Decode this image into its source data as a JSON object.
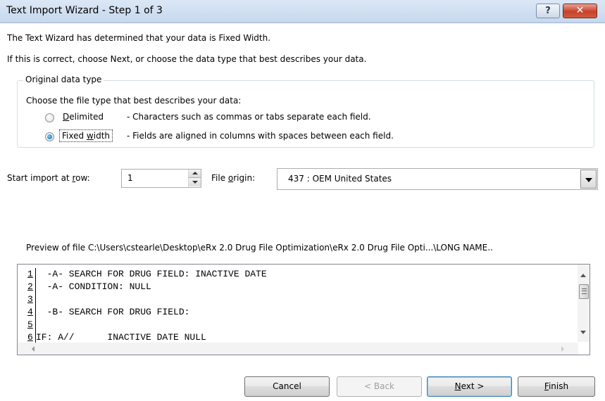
{
  "window": {
    "title": "Text Import Wizard - Step 1 of 3",
    "help_label": "?",
    "close_label": "✕"
  },
  "intro": {
    "line1": "The Text Wizard has determined that your data is Fixed Width.",
    "line2": "If this is correct, choose Next, or choose the data type that best describes your data."
  },
  "original_data_type": {
    "legend": "Original data type",
    "prompt": "Choose the file type that best describes your data:",
    "options": [
      {
        "label_prefix": "",
        "label_access": "D",
        "label_rest": "elimited",
        "description": "- Characters such as commas or tabs separate each field.",
        "checked": false
      },
      {
        "label_prefix": "Fixed ",
        "label_access": "w",
        "label_rest": "idth",
        "description": "- Fields are aligned in columns with spaces between each field.",
        "checked": true
      }
    ]
  },
  "start_import": {
    "label_prefix": "Start import at ",
    "label_access": "r",
    "label_rest": "ow:",
    "value": "1"
  },
  "file_origin": {
    "label_prefix": "File ",
    "label_access": "o",
    "label_rest": "rigin:",
    "value": "437 : OEM United States"
  },
  "preview": {
    "label": "Preview of file C:\\Users\\cstearle\\Desktop\\eRx 2.0 Drug File Optimization\\eRx 2.0 Drug File Opti...\\LONG NAME..",
    "lines": [
      {
        "num": "1",
        "text": "  -A- SEARCH FOR DRUG FIELD: INACTIVE DATE"
      },
      {
        "num": "2",
        "text": "  -A- CONDITION: NULL"
      },
      {
        "num": "3",
        "text": ""
      },
      {
        "num": "4",
        "text": "  -B- SEARCH FOR DRUG FIELD:"
      },
      {
        "num": "5",
        "text": ""
      },
      {
        "num": "6",
        "text": "IF: A//      INACTIVE DATE NULL"
      }
    ]
  },
  "buttons": {
    "cancel": "Cancel",
    "back": "< Back",
    "next_access": "N",
    "next_rest": "ext >",
    "finish_access": "F",
    "finish_rest": "inish"
  }
}
